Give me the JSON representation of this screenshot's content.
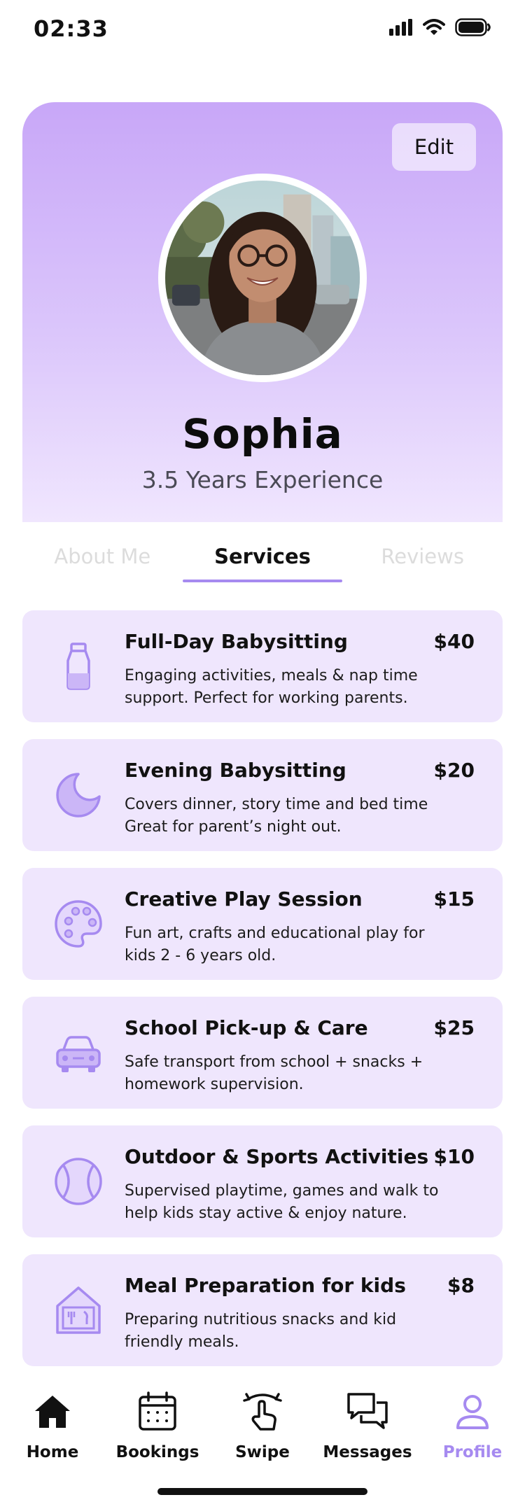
{
  "status_bar": {
    "time": "02:33"
  },
  "profile": {
    "edit_label": "Edit",
    "name": "Sophia",
    "experience": "3.5 Years Experience"
  },
  "tabs": [
    {
      "label": "About Me"
    },
    {
      "label": "Services"
    },
    {
      "label": "Reviews"
    }
  ],
  "active_tab": "Services",
  "services": [
    {
      "icon": "milk-bottle-icon",
      "title": "Full-Day Babysitting",
      "price": "$40",
      "description": "Engaging activities, meals & nap time support. Perfect for working parents."
    },
    {
      "icon": "moon-icon",
      "title": "Evening Babysitting",
      "price": "$20",
      "description": "Covers dinner, story time and bed time Great for parent’s night out."
    },
    {
      "icon": "palette-icon",
      "title": "Creative Play Session",
      "price": "$15",
      "description": "Fun art, crafts and educational play for kids 2 - 6 years old."
    },
    {
      "icon": "car-icon",
      "title": "School Pick-up & Care",
      "price": "$25",
      "description": "Safe transport from school + snacks + homework supervision."
    },
    {
      "icon": "ball-icon",
      "title": "Outdoor & Sports Activities",
      "price": "$10",
      "description": "Supervised playtime, games and walk to help kids stay active & enjoy nature."
    },
    {
      "icon": "kitchen-icon",
      "title": "Meal Preparation for kids",
      "price": "$8",
      "description": "Preparing nutritious snacks and kid friendly meals."
    }
  ],
  "nav": [
    {
      "icon": "home-icon",
      "label": "Home"
    },
    {
      "icon": "calendar-icon",
      "label": "Bookings"
    },
    {
      "icon": "swipe-icon",
      "label": "Swipe"
    },
    {
      "icon": "messages-icon",
      "label": "Messages"
    },
    {
      "icon": "profile-icon",
      "label": "Profile"
    }
  ],
  "active_nav": "Profile",
  "colors": {
    "accent": "#a68af0",
    "card_background": "#efe6fd",
    "header_gradient_top": "#c8a7f8",
    "header_gradient_bottom": "#f0e6fe"
  }
}
